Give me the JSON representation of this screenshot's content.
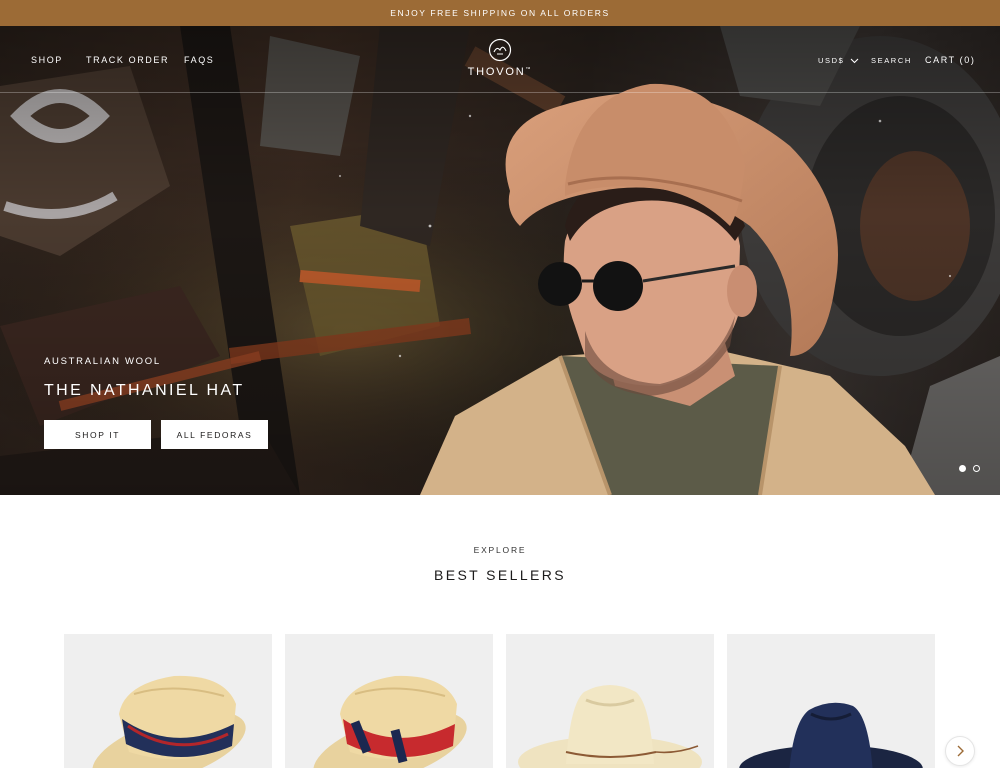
{
  "announcement": "ENJOY FREE SHIPPING ON ALL ORDERS",
  "nav": {
    "left": [
      "SHOP",
      "TRACK ORDER",
      "FAQS"
    ],
    "logo_text": "THOVON",
    "logo_tm": "™",
    "currency": "USD$",
    "search": "SEARCH",
    "cart": "CART (0)"
  },
  "hero": {
    "kicker": "AUSTRALIAN WOOL",
    "title": "THE NATHANIEL HAT",
    "buttons": [
      "SHOP IT",
      "ALL FEDORAS"
    ],
    "slide_count": 2,
    "active_slide": 1
  },
  "section": {
    "eyebrow": "EXPLORE",
    "title": "BEST SELLERS"
  },
  "products": [
    {
      "name": "straw-boater-navy-band-icon"
    },
    {
      "name": "straw-boater-red-band-icon"
    },
    {
      "name": "straw-fedora-icon"
    },
    {
      "name": "navy-fedora-icon"
    }
  ],
  "colors": {
    "announcement_bg": "#9c6b36",
    "hat_tan": "#c88d6a",
    "jacket": "#d3b289",
    "navy": "#1f2a45"
  }
}
